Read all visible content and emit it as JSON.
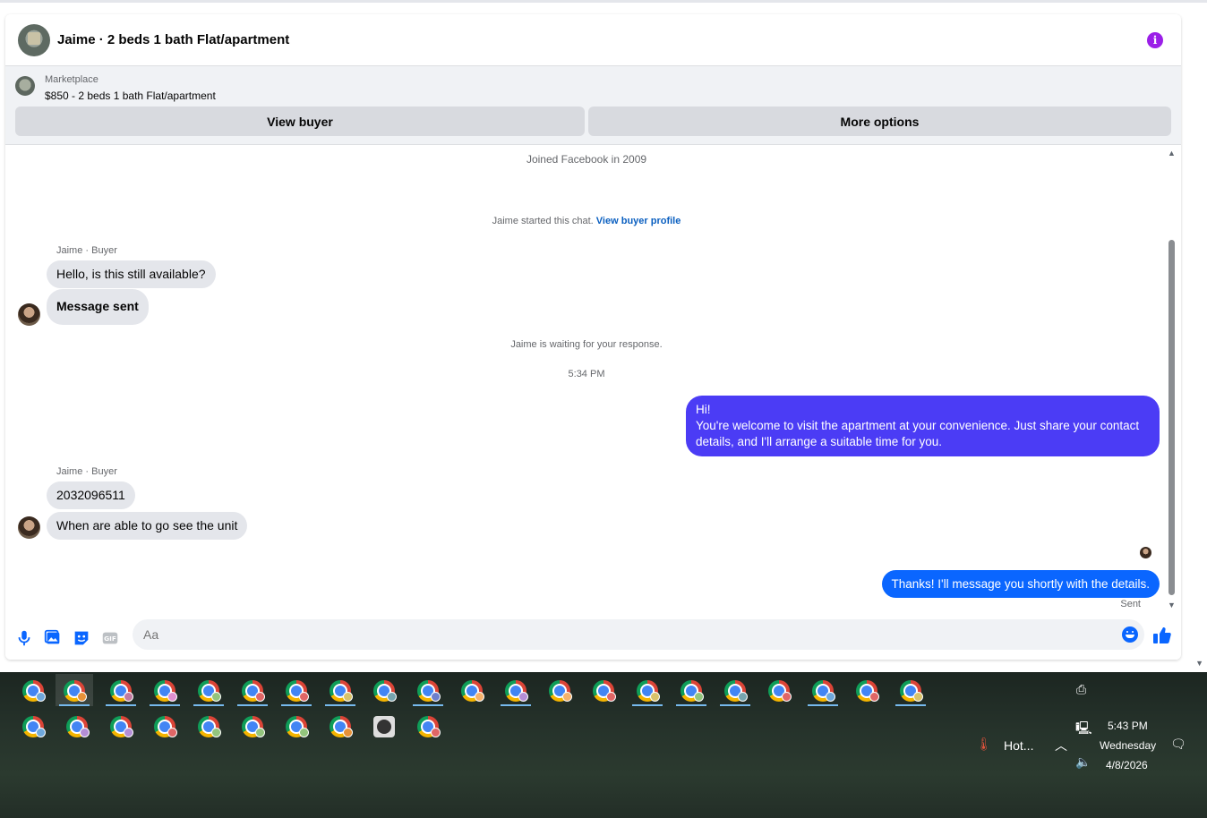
{
  "chat": {
    "title": "Jaime · 2 beds 1 bath Flat/apartment",
    "listing_label": "Marketplace",
    "listing_price": "$850 - 2 beds 1 bath Flat/apartment",
    "view_buyer": "View buyer",
    "more_options": "More options"
  },
  "messages": {
    "joined": "Joined Facebook in 2009",
    "started": "Jaime started this chat.",
    "view_profile": "View buyer profile",
    "sender1": "Jaime · Buyer",
    "msg1": "Hello, is this still available?",
    "msg2": "Message sent",
    "waiting": "Jaime is waiting for your response.",
    "time": "5:34 PM",
    "out1_line1": "Hi!",
    "out1_line2": "You're welcome to visit the apartment at your convenience. Just share your contact details, and I'll arrange a suitable time for you.",
    "sender2": "Jaime · Buyer",
    "msg3": "2032096511",
    "msg4": "When are able to go see the unit",
    "out2": "Thanks! I'll message you shortly with the details.",
    "sent": "Sent"
  },
  "composer": {
    "placeholder": "Aa"
  },
  "taskbar": {
    "weather": "Hot...",
    "time": "5:43 PM",
    "day": "Wednesday",
    "date": "4/8/2026"
  },
  "colors": {
    "outgoing_purple": "#4b3cf5",
    "outgoing_blue": "#0a66ff",
    "info_icon": "#9b1fe8",
    "link": "#0a5fc0"
  }
}
